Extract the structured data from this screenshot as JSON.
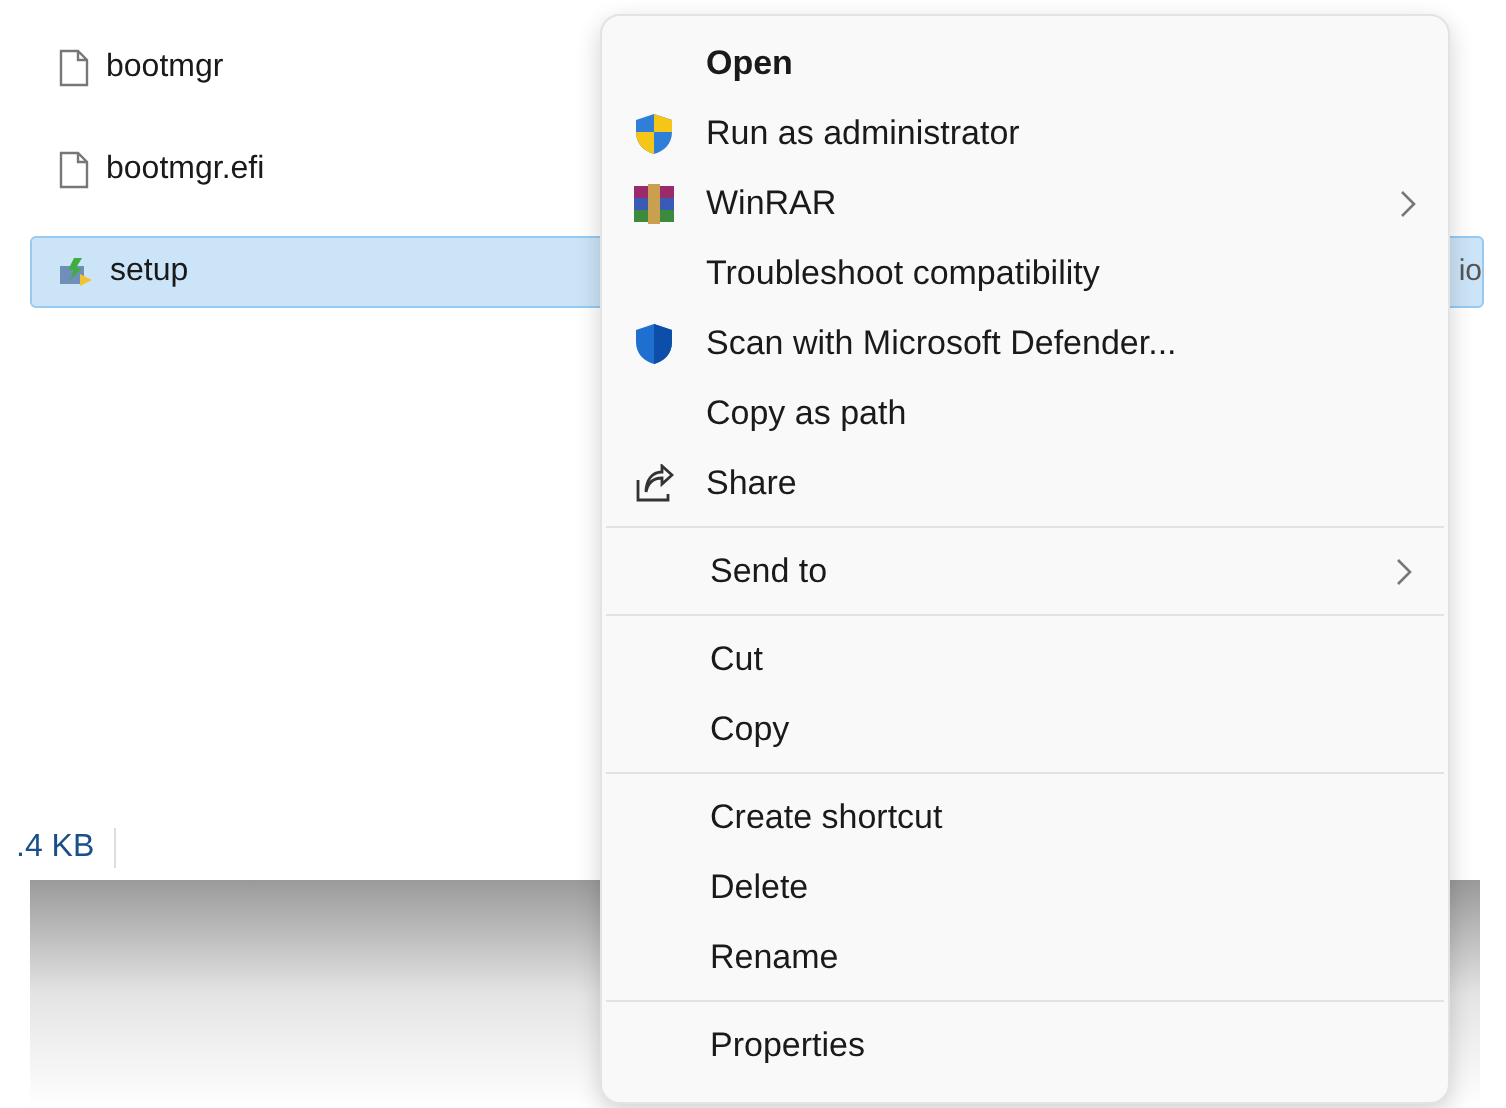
{
  "files": [
    {
      "name": "bootmgr",
      "kind": "document",
      "selected": false
    },
    {
      "name": "bootmgr.efi",
      "kind": "document",
      "selected": false
    },
    {
      "name": "setup",
      "kind": "installer",
      "selected": true,
      "trailing": "io"
    }
  ],
  "status_bar": {
    "size": ".4 KB"
  },
  "context_menu": {
    "sections": [
      {
        "items": [
          {
            "label": "Open",
            "kind": "plain",
            "default": true,
            "submenu": false
          },
          {
            "label": "Run as administrator",
            "kind": "admin",
            "default": false,
            "submenu": false
          },
          {
            "label": "WinRAR",
            "kind": "archive",
            "default": false,
            "submenu": true
          },
          {
            "label": "Troubleshoot compatibility",
            "kind": "plain",
            "default": false,
            "submenu": false
          },
          {
            "label": "Scan with Microsoft Defender...",
            "kind": "defender",
            "default": false,
            "submenu": false
          },
          {
            "label": "Copy as path",
            "kind": "plain",
            "default": false,
            "submenu": false
          },
          {
            "label": "Share",
            "kind": "share",
            "default": false,
            "submenu": false
          }
        ]
      },
      {
        "items": [
          {
            "label": "Send to",
            "kind": "plain",
            "default": false,
            "submenu": true
          }
        ]
      },
      {
        "items": [
          {
            "label": "Cut",
            "kind": "plain",
            "default": false,
            "submenu": false
          },
          {
            "label": "Copy",
            "kind": "plain",
            "default": false,
            "submenu": false
          }
        ]
      },
      {
        "items": [
          {
            "label": "Create shortcut",
            "kind": "plain",
            "default": false,
            "submenu": false
          },
          {
            "label": "Delete",
            "kind": "plain",
            "default": false,
            "submenu": false
          },
          {
            "label": "Rename",
            "kind": "plain",
            "default": false,
            "submenu": false
          }
        ]
      },
      {
        "items": [
          {
            "label": "Properties",
            "kind": "plain",
            "default": false,
            "submenu": false
          }
        ]
      }
    ]
  }
}
